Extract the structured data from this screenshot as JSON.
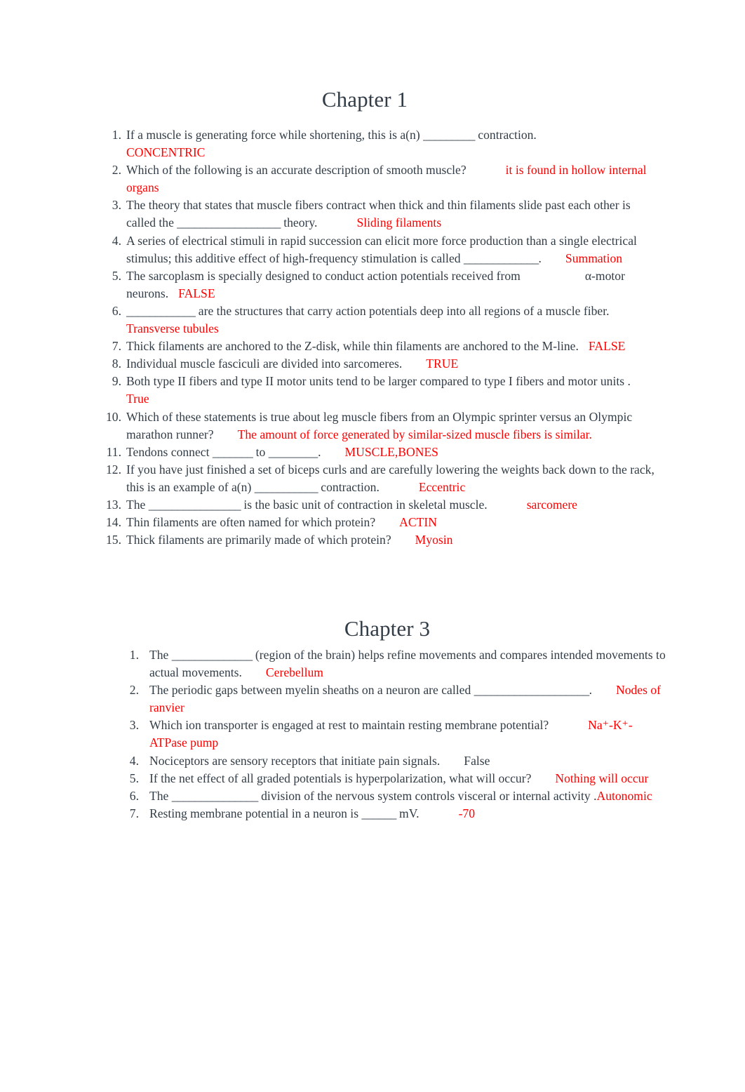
{
  "document": {
    "type": "study-guide-worksheet",
    "body_text_color": "#323d47",
    "answer_ink_color": "#ff0000"
  },
  "sections": [
    {
      "heading": "Chapter 1",
      "questions": [
        {
          "number": "1.",
          "prefix": "If a muscle is generating force while shortening, this is a(n) ",
          "blank": "_________",
          "suffix": " contraction.",
          "answer": "CONCENTRIC",
          "answer_color": "#ff0000",
          "answer_on_new_line": true
        },
        {
          "number": "2.",
          "prefix": "Which of the following is an accurate description of smooth muscle?",
          "blank": "",
          "suffix": "",
          "answer": "it is found in hollow internal organs",
          "answer_color": "#ff0000",
          "answer_on_new_line": false
        },
        {
          "number": "3.",
          "prefix": "The theory that states that muscle fibers contract when thick and thin filaments slide past each other is called the ",
          "blank": "__________________",
          "suffix": " theory.",
          "answer": "Sliding filaments",
          "answer_color": "#ff0000",
          "answer_on_new_line": false
        },
        {
          "number": "4.",
          "prefix": "A series of electrical stimuli in rapid succession can elicit more force production than a single electrical stimulus; this additive effect of high-frequency stimulation is called ",
          "blank": "_____________",
          "suffix": ".",
          "answer": "Summation",
          "answer_color": "#ff0000",
          "answer_on_new_line": false
        },
        {
          "number": "5.",
          "prefix": "The sarcoplasm is specially designed to conduct action potentials received from",
          "blank": "",
          "suffix": "α-motor neurons.",
          "answer": "FALSE",
          "answer_color": "#ff0000",
          "answer_on_new_line": false
        },
        {
          "number": "6.",
          "prefix": "",
          "blank": "____________",
          "suffix": " are the structures that carry action potentials deep into all regions of a muscle fiber.",
          "answer": "Transverse tubules",
          "answer_color": "#ff0000",
          "answer_on_new_line": false
        },
        {
          "number": "7.",
          "prefix": "Thick filaments are anchored to the Z-disk, while thin filaments are anchored to the M-line.",
          "blank": "",
          "suffix": "",
          "answer": "FALSE",
          "answer_color": "#ff0000",
          "answer_on_new_line": false
        },
        {
          "number": "8.",
          "prefix": "Individual muscle fasciculi are divided into sarcomeres.",
          "blank": "",
          "suffix": "",
          "answer": "TRUE",
          "answer_color": "#ff0000",
          "answer_on_new_line": false
        },
        {
          "number": "9.",
          "prefix": "Both type II fibers and type II motor units tend to be larger compared to type I fibers and motor units .",
          "blank": "",
          "suffix": "",
          "answer": "True",
          "answer_color": "#ff0000",
          "answer_on_new_line": false
        },
        {
          "number": "10.",
          "prefix": "Which of these statements is true about leg muscle fibers from an Olympic sprinter versus an Olympic marathon runner?",
          "blank": "",
          "suffix": "",
          "answer": "The amount of force generated by similar-sized muscle fibers is similar.",
          "answer_color": "#ff0000",
          "answer_on_new_line": false
        },
        {
          "number": "11.",
          "prefix": "Tendons connect ",
          "blank": "_______",
          "suffix": " to ________.",
          "answer": "MUSCLE,BONES",
          "answer_color": "#ff0000",
          "answer_on_new_line": false
        },
        {
          "number": "12.",
          "prefix": "If you have just finished a set of biceps curls and are carefully lowering the weights back down to the rack, this is an example of a(n) ",
          "blank": "___________",
          "suffix": " contraction.",
          "answer": "Eccentric",
          "answer_color": "#ff0000",
          "answer_on_new_line": false
        },
        {
          "number": "13.",
          "prefix": "The ",
          "blank": "________________",
          "suffix": " is the basic unit of contraction in skeletal muscle.",
          "answer": "sarcomere",
          "answer_color": "#ff0000",
          "answer_on_new_line": false
        },
        {
          "number": "14.",
          "prefix": "Thin filaments are often named for which protein?",
          "blank": "",
          "suffix": "",
          "answer": "ACTIN",
          "answer_color": "#ff0000",
          "answer_on_new_line": false
        },
        {
          "number": "15.",
          "prefix": "Thick filaments are primarily made of which protein?",
          "blank": "",
          "suffix": "",
          "answer": "Myosin",
          "answer_color": "#ff0000",
          "answer_on_new_line": false
        }
      ]
    },
    {
      "heading": "Chapter 3",
      "questions": [
        {
          "number": "1.",
          "prefix": "The ",
          "blank": "______________",
          "suffix": " (region of the brain) helps refine movements and compares intended movements to actual movements.",
          "answer": "Cerebellum",
          "answer_color": "#ff0000",
          "answer_on_new_line": false
        },
        {
          "number": "2.",
          "prefix": "The periodic gaps between myelin sheaths on a neuron are called ",
          "blank": "____________________",
          "suffix": ".",
          "answer": "Nodes of ranvier",
          "answer_color": "#ff0000",
          "answer_on_new_line": false
        },
        {
          "number": "3.",
          "prefix": "Which ion transporter is engaged at rest to maintain resting membrane potential?",
          "blank": "",
          "suffix": "",
          "answer": "Na⁺-K⁺-ATPase pump",
          "answer_color": "#ff0000",
          "answer_on_new_line": false
        },
        {
          "number": "4.",
          "prefix": "Nociceptors are sensory receptors that initiate pain signals.",
          "blank": "",
          "suffix": "",
          "answer": "False",
          "answer_color": "#323d47",
          "answer_on_new_line": false
        },
        {
          "number": "5.",
          "prefix": "If the net effect of all graded potentials is hyperpolarization, what will occur?",
          "blank": "",
          "suffix": "",
          "answer": "Nothing will occur",
          "answer_color": "#ff0000",
          "answer_on_new_line": false
        },
        {
          "number": "6.",
          "prefix": "The ",
          "blank": "_______________",
          "suffix": " division of the nervous system controls visceral or internal activity .",
          "answer": "Autonomic",
          "answer_color": "#ff0000",
          "answer_on_new_line": false
        },
        {
          "number": "7.",
          "prefix": "Resting membrane potential in a neuron is ",
          "blank": "______",
          "suffix": " mV.",
          "answer": "-70",
          "answer_color": "#ff0000",
          "answer_on_new_line": false
        }
      ]
    }
  ]
}
